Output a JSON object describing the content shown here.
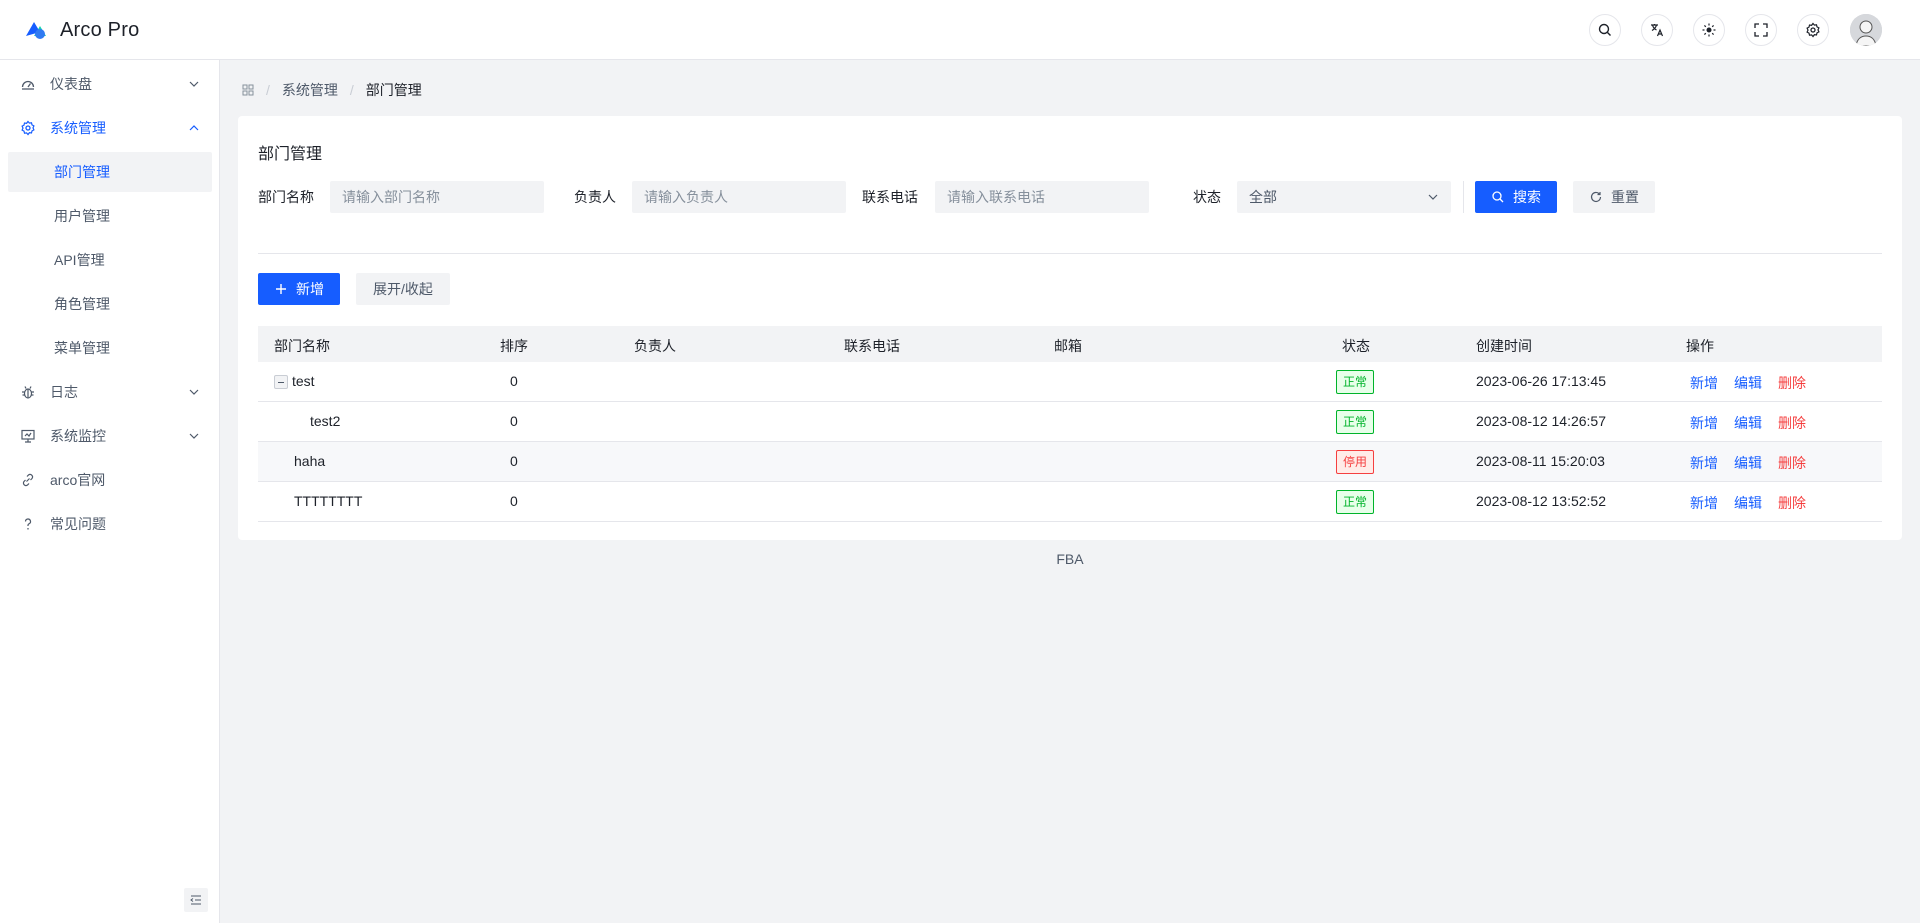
{
  "app": {
    "title": "Arco Pro"
  },
  "header": {
    "icons": [
      "search-icon",
      "translate-icon",
      "theme-icon",
      "fullscreen-icon",
      "settings-icon"
    ]
  },
  "sidebar": {
    "items": [
      {
        "label": "仪表盘",
        "icon": "dashboard-icon"
      },
      {
        "label": "系统管理",
        "icon": "settings-icon"
      },
      {
        "label": "部门管理"
      },
      {
        "label": "用户管理"
      },
      {
        "label": "API管理"
      },
      {
        "label": "角色管理"
      },
      {
        "label": "菜单管理"
      },
      {
        "label": "日志",
        "icon": "bug-icon"
      },
      {
        "label": "系统监控",
        "icon": "monitor-icon"
      },
      {
        "label": "arco官网",
        "icon": "link-icon"
      },
      {
        "label": "常见问题",
        "icon": "question-icon"
      }
    ]
  },
  "breadcrumb": {
    "items": [
      "系统管理",
      "部门管理"
    ]
  },
  "card": {
    "title": "部门管理"
  },
  "filters": {
    "dept_name": {
      "label": "部门名称",
      "placeholder": "请输入部门名称"
    },
    "leader": {
      "label": "负责人",
      "placeholder": "请输入负责人"
    },
    "phone": {
      "label": "联系电话",
      "placeholder": "请输入联系电话"
    },
    "status": {
      "label": "状态",
      "value": "全部"
    },
    "search_label": "搜索",
    "reset_label": "重置"
  },
  "toolbar": {
    "add_label": "新增",
    "toggle_label": "展开/收起"
  },
  "table": {
    "columns": [
      "部门名称",
      "排序",
      "负责人",
      "联系电话",
      "邮箱",
      "状态",
      "创建时间",
      "操作"
    ],
    "rows": [
      {
        "name": "test",
        "sort": "0",
        "status": "正常",
        "created": "2023-06-26 17:13:45"
      },
      {
        "name": "test2",
        "sort": "0",
        "status": "正常",
        "created": "2023-08-12 14:26:57"
      },
      {
        "name": "haha",
        "sort": "0",
        "status": "停用",
        "created": "2023-08-11 15:20:03"
      },
      {
        "name": "TTTTTTTT",
        "sort": "0",
        "status": "正常",
        "created": "2023-08-12 13:52:52"
      }
    ],
    "actions": {
      "add": "新增",
      "edit": "编辑",
      "delete": "删除"
    }
  },
  "footer": {
    "text": "FBA"
  },
  "colors": {
    "primary": "#165dff",
    "success": "#00b42a",
    "danger": "#f53f3f"
  }
}
